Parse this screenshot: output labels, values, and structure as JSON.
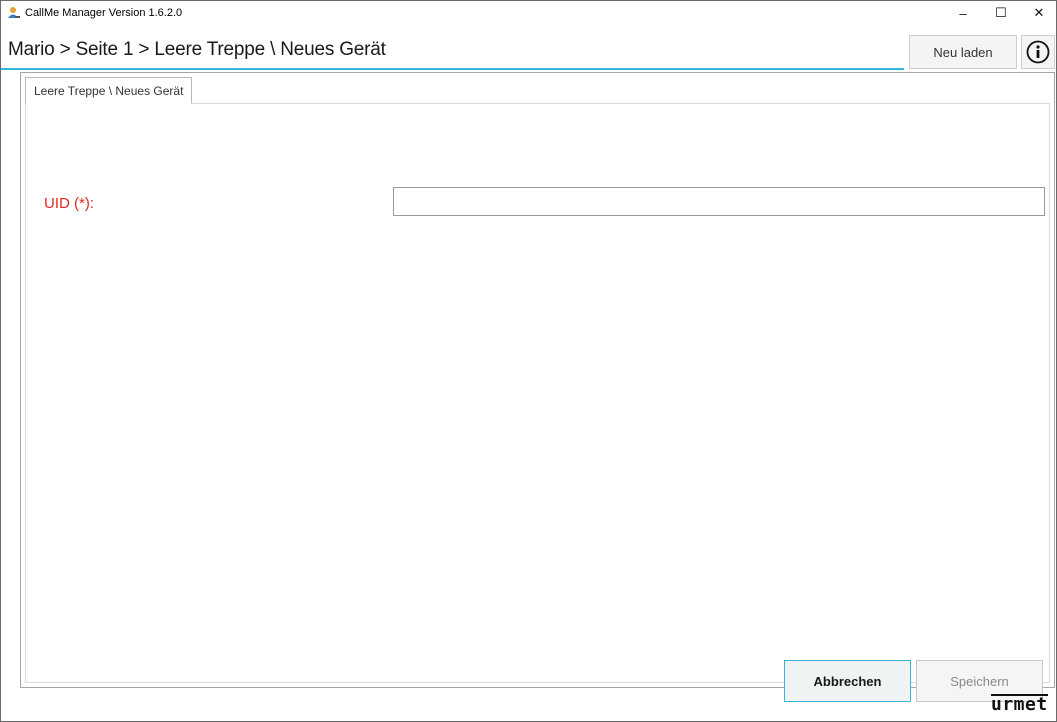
{
  "window": {
    "title": "CallMe Manager Version 1.6.2.0",
    "controls": {
      "minimize": "–",
      "maximize": "☐",
      "close": "✕"
    }
  },
  "header": {
    "breadcrumb": "Mario > Seite 1 > Leere Treppe \\ Neues Gerät",
    "reload_label": "Neu laden",
    "info_icon": "info-icon",
    "accent_color": "#32b8da"
  },
  "tabs": [
    {
      "label": "Leere Treppe \\ Neues Gerät",
      "active": true
    }
  ],
  "form": {
    "uid_label": "UID (*):",
    "uid_value": "",
    "required_color": "#e0281e"
  },
  "actions": {
    "cancel_label": "Abbrechen",
    "save_label": "Speichern"
  },
  "brand": {
    "logo_text": "urmet"
  }
}
